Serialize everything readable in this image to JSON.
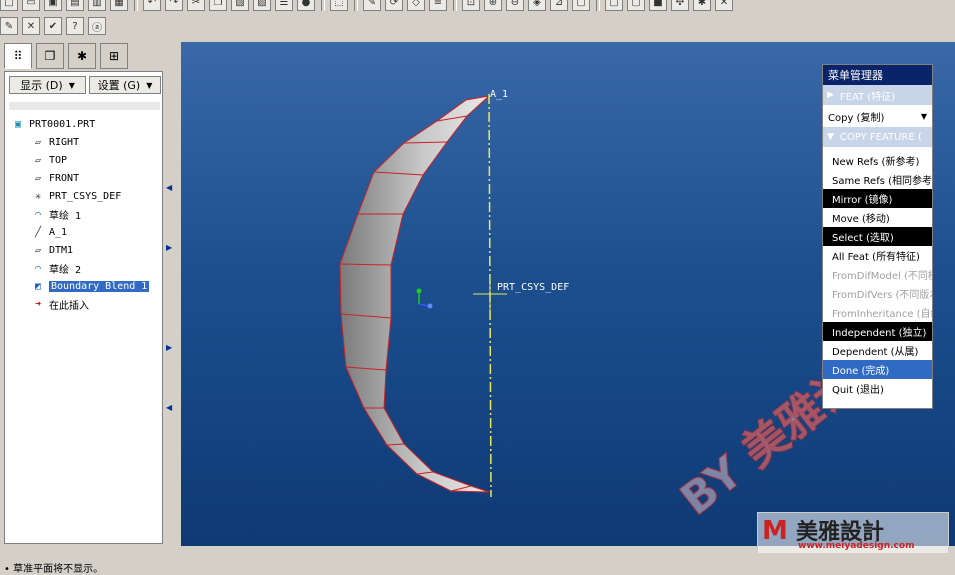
{
  "toolbar": {
    "row1_icons": [
      "new-icon",
      "open-icon",
      "save-icon",
      "save-copy-icon",
      "print-icon",
      "save-image-icon",
      "undo-icon",
      "redo-icon",
      "cut-icon",
      "copy-icon",
      "paste-icon",
      "paste-special-icon",
      "table-icon",
      "binoculars-icon",
      "select-box-icon",
      "sketch-icon",
      "regenerate-icon",
      "datum-display-icon",
      "layer-icon",
      "zoom-fit-icon",
      "zoom-in-icon",
      "zoom-out-icon",
      "view-icon",
      "orient-icon",
      "display-style-icon",
      "hidden-line-icon",
      "no-hidden-icon",
      "shading-icon",
      "csys-icon",
      "spin-center-icon",
      "close-icon"
    ],
    "row2_icons": [
      "edit-icon",
      "close-window-icon",
      "check-icon",
      "help-icon",
      "info-icon"
    ]
  },
  "left_panel": {
    "tabs": [
      "model-tree-tab",
      "folder-tab",
      "favorites-tab",
      "layers-tab"
    ],
    "show_button": "显示 (D)",
    "settings_button": "设置 (G)",
    "tree": [
      {
        "label": "PRT0001.PRT",
        "icon": "part-icon"
      },
      {
        "label": "RIGHT",
        "icon": "datum-plane-icon"
      },
      {
        "label": "TOP",
        "icon": "datum-plane-icon"
      },
      {
        "label": "FRONT",
        "icon": "datum-plane-icon"
      },
      {
        "label": "PRT_CSYS_DEF",
        "icon": "csys-icon"
      },
      {
        "label": "草绘 1",
        "icon": "sketch-icon"
      },
      {
        "label": "A_1",
        "icon": "axis-icon"
      },
      {
        "label": "DTM1",
        "icon": "datum-plane-icon"
      },
      {
        "label": "草绘 2",
        "icon": "sketch-icon"
      },
      {
        "label": "Boundary Blend 1",
        "icon": "boundary-blend-icon"
      },
      {
        "label": "在此插入",
        "icon": "insert-here-arrow-icon"
      }
    ]
  },
  "viewport": {
    "axis_label": "A_1",
    "csys_label": "PRT_CSYS_DEF",
    "csys_y": "Y",
    "csys_z": "Z",
    "watermark": "BY 美雅设计"
  },
  "menu_manager": {
    "title": "菜单管理器",
    "feat_header": "FEAT (特征)",
    "copy_dropdown": "Copy (复制)",
    "copy_feature_header": "COPY FEATURE (",
    "items": [
      {
        "label": "New Refs (新参考)",
        "style": "normal"
      },
      {
        "label": "Same Refs (相同参考)",
        "style": "normal"
      },
      {
        "label": "Mirror (镜像)",
        "style": "black"
      },
      {
        "label": "Move (移动)",
        "style": "normal"
      },
      {
        "label": "Select (选取)",
        "style": "black"
      },
      {
        "label": "All Feat (所有特征)",
        "style": "normal"
      },
      {
        "label": "FromDifModel (不同模型)",
        "style": "grey"
      },
      {
        "label": "FromDifVers (不同版本)",
        "style": "grey"
      },
      {
        "label": "FromInheritance (自继承)",
        "style": "grey"
      },
      {
        "label": "Independent (独立)",
        "style": "black"
      },
      {
        "label": "Dependent (从属)",
        "style": "normal"
      },
      {
        "label": "Done (完成)",
        "style": "highlight"
      },
      {
        "label": "Quit (退出)",
        "style": "normal"
      }
    ]
  },
  "status": {
    "text": "• 草准平面将不显示。"
  },
  "logo": {
    "mark": "M",
    "name": "美雅設計",
    "url": "www.meiyadesign.com"
  },
  "colors": {
    "viewport_top": "#3a68a8",
    "viewport_bottom": "#0e3a74",
    "axis_yellow": "#ffff66",
    "edge_red": "#cc0000",
    "menu_title": "#0a246a",
    "selected": "#316ac5"
  }
}
